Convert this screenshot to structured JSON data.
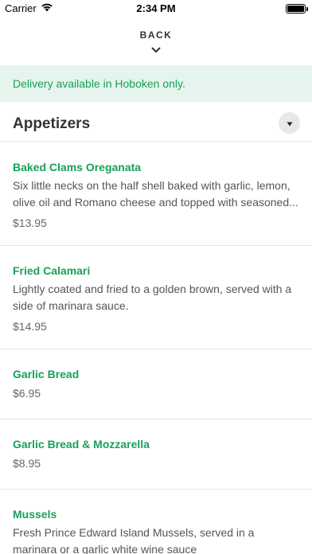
{
  "status_bar": {
    "carrier": "Carrier",
    "time": "2:34 PM"
  },
  "nav": {
    "back_label": "BACK"
  },
  "banner": {
    "text": "Delivery available in Hoboken only."
  },
  "section": {
    "title": "Appetizers"
  },
  "menu_items": [
    {
      "name": "Baked Clams Oreganata",
      "description": "Six little necks on the half shell baked with garlic, lemon, olive oil and Romano cheese and topped with seasoned...",
      "price": "$13.95"
    },
    {
      "name": "Fried Calamari",
      "description": "Lightly coated and fried to a golden brown, served with a side of marinara sauce.",
      "price": "$14.95"
    },
    {
      "name": "Garlic Bread",
      "description": "",
      "price": "$6.95"
    },
    {
      "name": "Garlic Bread & Mozzarella",
      "description": "",
      "price": "$8.95"
    },
    {
      "name": "Mussels",
      "description": "Fresh Prince Edward Island Mussels, served in a marinara or a garlic white wine sauce",
      "price": ""
    }
  ],
  "colors": {
    "accent_green": "#18a058",
    "banner_bg": "#e5f4ec"
  }
}
